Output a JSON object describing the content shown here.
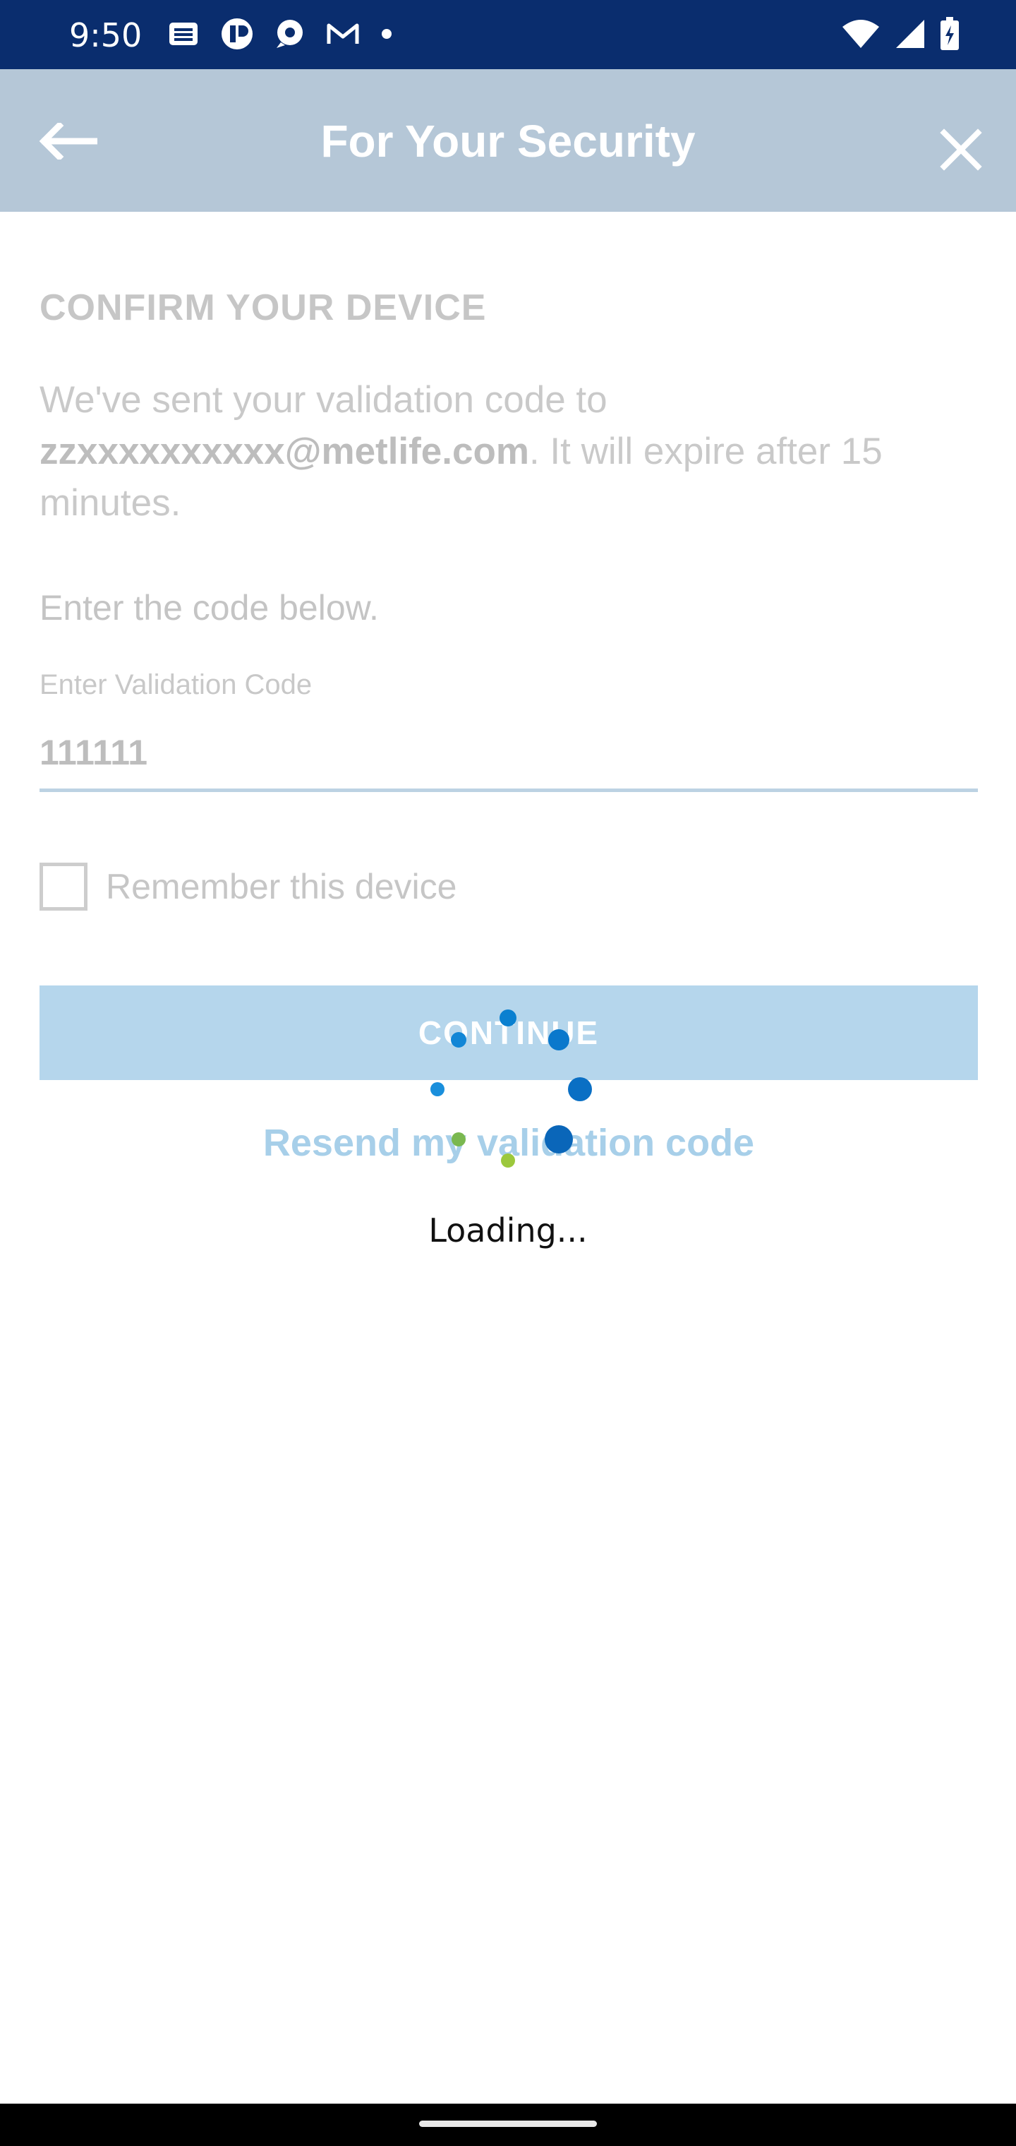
{
  "status_bar": {
    "time": "9:50",
    "left_icons": [
      "news-icon",
      "app-icon",
      "pin-icon",
      "gmail-icon",
      "dot-icon"
    ],
    "right_icons": [
      "wifi-icon",
      "signal-icon",
      "battery-icon"
    ]
  },
  "header": {
    "title": "For Your Security",
    "back_icon": "arrow-left-icon",
    "close_icon": "close-icon",
    "background": "#b5c7d7"
  },
  "form": {
    "heading": "CONFIRM YOUR DEVICE",
    "message_prefix": "We've sent your validation code to ",
    "email": "zzxxxxxxxxxx@metlife.com",
    "message_suffix": ". It will expire after 15 minutes.",
    "prompt": "Enter the code below.",
    "code_label": "Enter Validation Code",
    "code_value": "111111",
    "remember_label": "Remember this device",
    "remember_checked": false,
    "continue_label": "CONTINUE",
    "resend_label": "Resend my validation code"
  },
  "loading": {
    "text": "Loading..."
  },
  "colors": {
    "status_bar": "#0a2d6e",
    "accent_blue": "#0a75c9",
    "accent_green": "#8cc63f",
    "button": "#b5d6ec",
    "link": "#a7cfe9"
  }
}
